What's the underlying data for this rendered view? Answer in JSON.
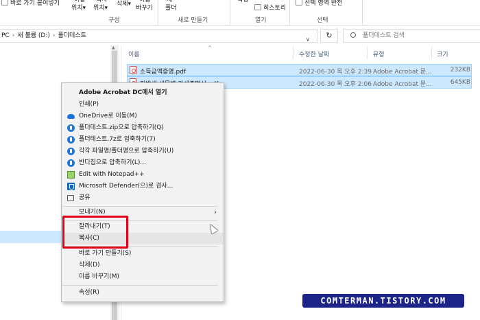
{
  "ribbon": {
    "shortcut_paste": "바로 가기 붙여넣기",
    "move_to_top": "이동",
    "move_to": "위치▾",
    "copy_to_top": "복사",
    "copy_to": "위치▾",
    "group_organize": "구성",
    "delete_label": "삭제▾",
    "rename_top": "이름",
    "rename": "바꾸기",
    "new_folder_top": "새",
    "new_folder": "폴더",
    "group_new": "새로 만들기",
    "properties_top": "속성",
    "history": "히스토리",
    "group_open": "열기",
    "invert_selection": "선택 영역 반전",
    "group_select": "선택"
  },
  "address": {
    "crumbs": [
      "PC",
      "새 볼륨 (D:)",
      "폴더테스트"
    ],
    "chevron": "∨",
    "refresh": "↻",
    "search_placeholder": "폴더테스트 검색"
  },
  "columns": {
    "name": "이름",
    "date": "수정한 날짜",
    "type": "유형",
    "size": "크기"
  },
  "files": [
    {
      "name": "소득금액증명.pdf",
      "date": "2022-06-30 목 오후 2:39",
      "type": "Adobe Acrobat 문...",
      "size": "232KB"
    },
    {
      "name": "지방세 세목별 과세증명서.pdf",
      "date": "2022-06-30 목 오후 2:06",
      "type": "Adobe Acrobat 문...",
      "size": "645KB"
    }
  ],
  "context_menu": {
    "open_acrobat": "Adobe Acrobat DC에서 열기",
    "print": "인쇄(P)",
    "onedrive_move": "OneDrive로 이동(M)",
    "zip_compress": "폴더테스트.zip으로 압축하기(Q)",
    "sevenz_compress": "폴더테스트.7z로 압축하기(7)",
    "each_compress": "각각 파일명/폴더명으로 압축하기(U)",
    "bandizip_compress": "반디집으로 압축하기(L)...",
    "notepad": "Edit with Notepad++",
    "defender": "Microsoft Defender(으)로 검사...",
    "share": "공유",
    "send_to": "보내기(N)",
    "submenu_arrow": "›",
    "cut": "잘라내기(T)",
    "copy": "복사(C)",
    "create_shortcut": "바로 가기 만들기(S)",
    "delete": "삭제(D)",
    "rename": "이름 바꾸기(M)",
    "properties": "속성(R)"
  },
  "watermark": "COMTERMAN.TISTORY.COM",
  "colors": {
    "selection": "#cce8ff",
    "selection_border": "#99d1ff",
    "highlight_red": "#e4001a",
    "watermark_bg": "#1c2487"
  }
}
